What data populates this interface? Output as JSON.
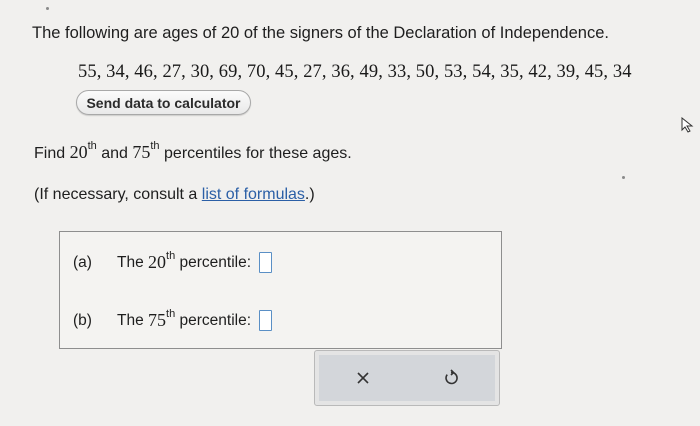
{
  "problem": {
    "statement": "The following are ages of 20 of the signers of the Declaration of Independence.",
    "data_values": "55, 34, 46, 27, 30, 69, 70, 45, 27, 36, 49, 33, 50, 53, 54, 35, 42, 39, 45, 34"
  },
  "calculator_button": {
    "label": "Send data to calculator"
  },
  "instruction": {
    "find": "Find",
    "first_number": "20",
    "first_suffix": "th",
    "and": "and",
    "second_number": "75",
    "second_suffix": "th",
    "rest": "percentiles for these ages."
  },
  "formula_note": {
    "before": "(If necessary, consult a",
    "link": "list of formulas",
    "after": ".)"
  },
  "answers": [
    {
      "part": "(a)",
      "prefix": "The",
      "number": "20",
      "suffix": "th",
      "label": "percentile:",
      "value": ""
    },
    {
      "part": "(b)",
      "prefix": "The",
      "number": "75",
      "suffix": "th",
      "label": "percentile:",
      "value": ""
    }
  ],
  "tools": {
    "clear_icon": "x-icon",
    "reset_icon": "undo-icon"
  },
  "colors": {
    "background": "#f1f0ee",
    "link": "#2b5fa6",
    "input_border": "#5a8fc5",
    "toolbar": "#d3d6da"
  }
}
